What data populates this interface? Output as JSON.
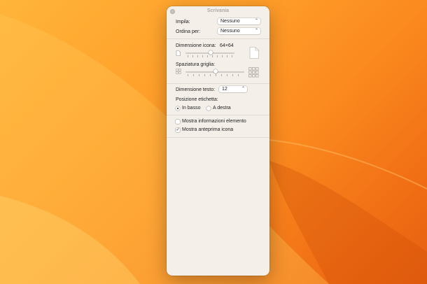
{
  "window": {
    "title": "Scrivania"
  },
  "arrange": {
    "label": "Impila:",
    "value": "Nessuno"
  },
  "sort": {
    "label": "Ordina per:",
    "value": "Nessuno"
  },
  "icon_size": {
    "label": "Dimensione icona:",
    "value": "64×64",
    "level": 0.5
  },
  "grid_spacing": {
    "label": "Spaziatura griglia:",
    "level": 0.5
  },
  "text_size": {
    "label": "Dimensione testo:",
    "value": "12"
  },
  "label_position": {
    "label": "Posizione etichetta:",
    "options": [
      {
        "label": "In basso",
        "selected": true
      },
      {
        "label": "A destra",
        "selected": false
      }
    ]
  },
  "options": [
    {
      "label": "Mostra informazioni elemento",
      "checked": false
    },
    {
      "label": "Mostra anteprima icona",
      "checked": true
    }
  ],
  "colors": {
    "wallpaper_top": "#ffb53a",
    "wallpaper_bottom": "#e65f10",
    "window_bg": "#f4efe9"
  }
}
